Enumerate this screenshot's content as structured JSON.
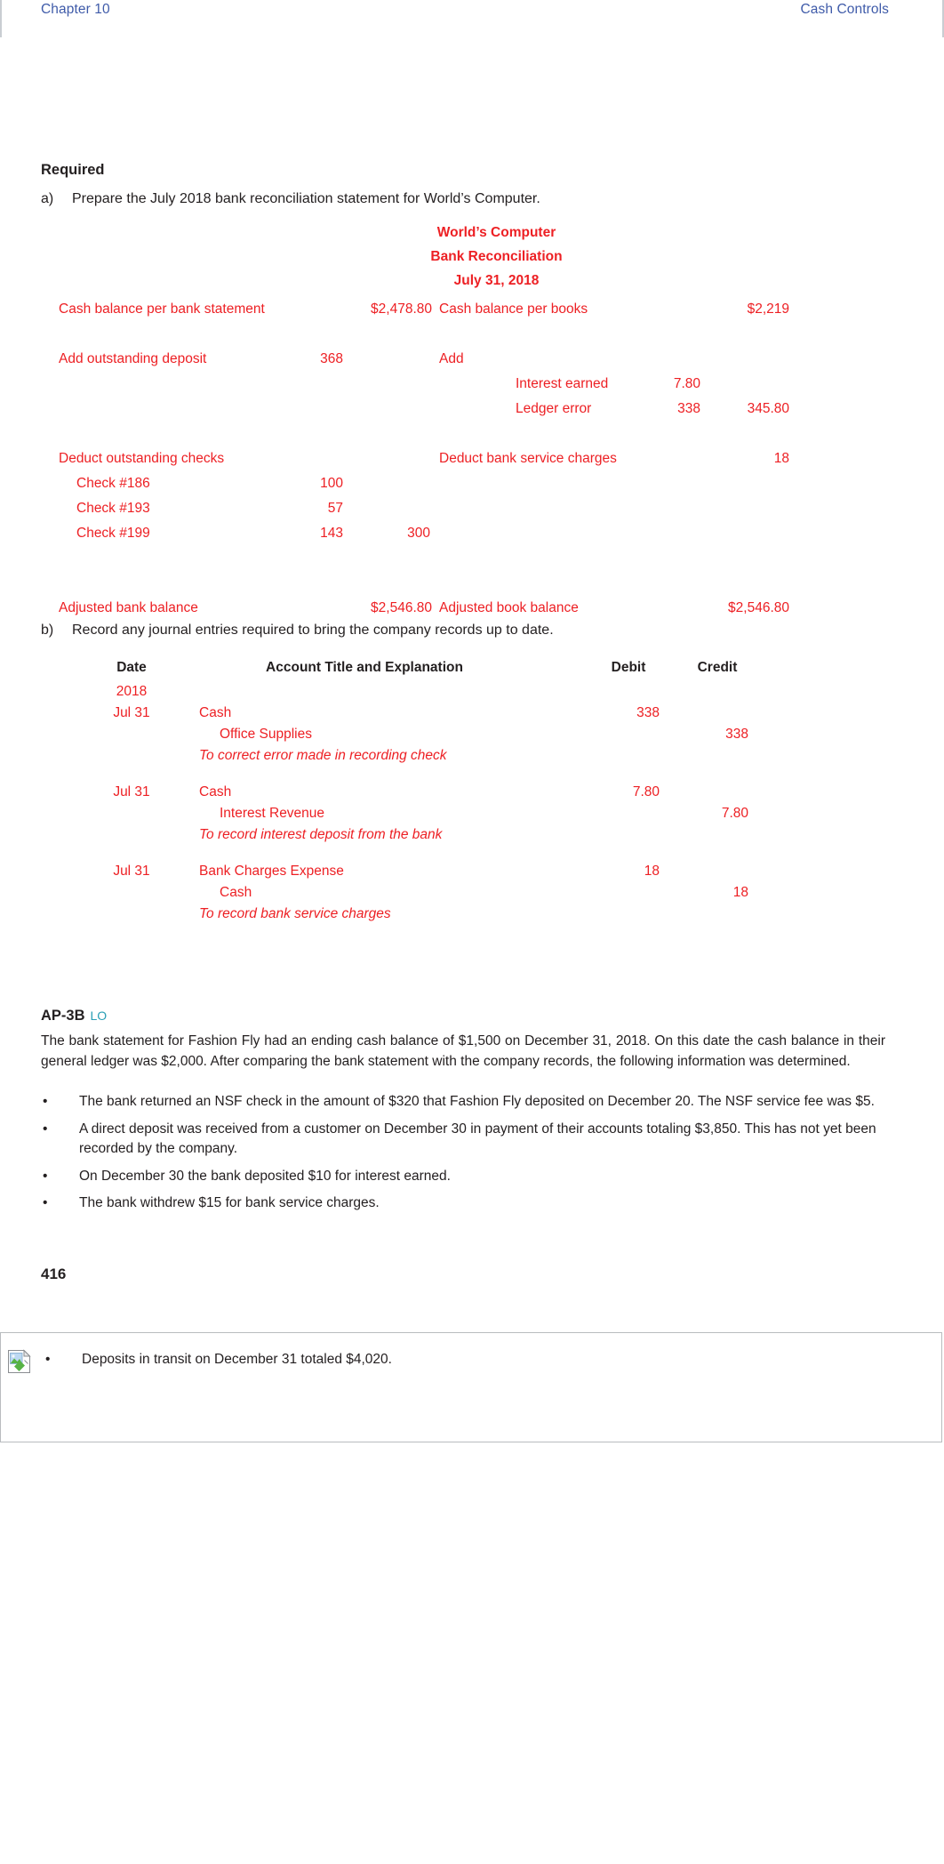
{
  "runhead": {
    "chapter": "Chapter 10",
    "section": "Cash Controls",
    "link_color": "#3f5ba9"
  },
  "required": {
    "heading": "Required",
    "item_a_marker": "a)",
    "item_a_text": "Prepare the July 2018 bank reconciliation statement for World’s Computer.",
    "item_b_marker": "b)",
    "item_b_text": "Record any journal entries required to bring the company records up to date."
  },
  "reconciliation": {
    "accent_color": "#ed2024",
    "title_line1": "World’s Computer",
    "title_line2": "Bank Reconciliation",
    "title_line3": "July 31, 2018",
    "rows": [
      {
        "bank_label": "Cash balance per bank statement",
        "bank_total": "$2,478.80",
        "book_label": "Cash balance per books",
        "book_total": "$2,219"
      },
      {
        "bank_label": "Add outstanding deposit",
        "bank_num1": "368",
        "book_label": "Add"
      },
      {
        "book_sub": "Interest earned",
        "book_num1": "7.80"
      },
      {
        "book_sub": "Ledger error",
        "book_num1": "338",
        "book_num2": "345.80"
      },
      {
        "bank_label": "Deduct outstanding checks",
        "book_label": "Deduct bank service charges",
        "book_num2": "18"
      },
      {
        "bank_sub": "Check #186",
        "bank_num1": "100"
      },
      {
        "bank_sub": "Check #193",
        "bank_num1": "57"
      },
      {
        "bank_sub": "Check #199",
        "bank_num1": "143",
        "bank_num2": "300"
      },
      {
        "bank_label": "Adjusted bank balance",
        "bank_total": "$2,546.80",
        "book_label": "Adjusted book balance",
        "book_total": "$2,546.80"
      }
    ]
  },
  "journal": {
    "headers": {
      "date": "Date",
      "account": "Account Title and Explanation",
      "debit": "Debit",
      "credit": "Credit"
    },
    "year": "2018",
    "entries": [
      {
        "date": "Jul 31",
        "debit_account": "Cash",
        "debit_amount": "338",
        "credit_account": "Office Supplies",
        "credit_amount": "338",
        "explanation": "To correct error made in recording check"
      },
      {
        "date": "Jul 31",
        "debit_account": "Cash",
        "debit_amount": "7.80",
        "credit_account": "Interest Revenue",
        "credit_amount": "7.80",
        "explanation": "To record interest deposit from the bank"
      },
      {
        "date": "Jul 31",
        "debit_account": "Bank Charges Expense",
        "debit_amount": "18",
        "credit_account": "Cash",
        "credit_amount": "18",
        "explanation": "To record bank service charges"
      }
    ]
  },
  "problem": {
    "code": "AP-3B",
    "lo_tag": "LO",
    "lo_color": "#2a9fb5",
    "intro": "The bank statement for Fashion Fly had an ending cash balance of $1,500 on December 31, 2018. On this date the cash balance in their general ledger was $2,000. After comparing the bank statement with the company records, the following information was determined.",
    "bullet_marker": "•",
    "bullets": [
      "The bank returned an NSF check in the amount of $320 that Fashion Fly deposited on December 20. The NSF service fee was $5.",
      "A direct deposit was received from a customer on December 30 in payment of their accounts totaling $3,850. This has not yet been recorded by the company.",
      "On December 30 the bank deposited $10 for interest earned.",
      "The bank withdrew $15 for bank service charges."
    ]
  },
  "page_number": "416",
  "fragment": {
    "bullet_marker": "•",
    "bullet_text": "Deposits in transit on December 31 totaled $4,020.",
    "image_icon": "broken-image-placeholder-icon"
  }
}
